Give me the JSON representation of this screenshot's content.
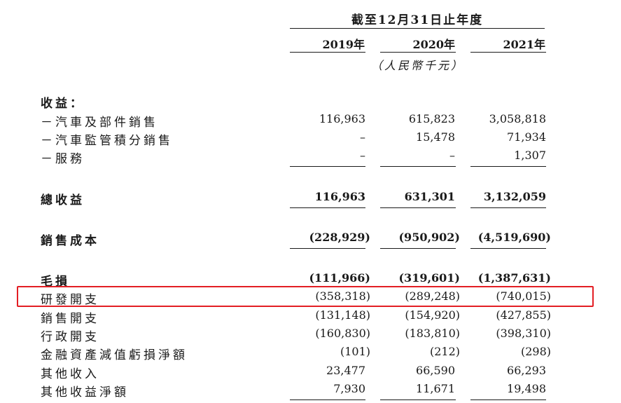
{
  "header": {
    "title": "截至12月31日止年度",
    "years": [
      "2019年",
      "2020年",
      "2021年"
    ],
    "unit": "（人民幣千元）"
  },
  "rows": {
    "revenue_heading": "收益：",
    "vehicle_sales": {
      "label": "－汽車及部件銷售",
      "values": [
        "116,963",
        "615,823",
        "3,058,818"
      ]
    },
    "credit_sales": {
      "label": "－汽車監管積分銷售",
      "values": [
        "–",
        "15,478",
        "71,934"
      ]
    },
    "services": {
      "label": "－服務",
      "values": [
        "–",
        "–",
        "1,307"
      ]
    },
    "total_revenue": {
      "label": "總收益",
      "values": [
        "116,963",
        "631,301",
        "3,132,059"
      ]
    },
    "cost_of_sales": {
      "label": "銷售成本",
      "values": [
        "(228,929)",
        "(950,902)",
        "(4,519,690)"
      ]
    },
    "gross_loss": {
      "label": "毛損",
      "values": [
        "(111,966)",
        "(319,601)",
        "(1,387,631)"
      ]
    },
    "rd_expenses": {
      "label": "研發開支",
      "values": [
        "(358,318)",
        "(289,248)",
        "(740,015)"
      ]
    },
    "selling_expenses": {
      "label": "銷售開支",
      "values": [
        "(131,148)",
        "(154,920)",
        "(427,855)"
      ]
    },
    "admin_expenses": {
      "label": "行政開支",
      "values": [
        "(160,830)",
        "(183,810)",
        "(398,310)"
      ]
    },
    "impairment_losses": {
      "label": "金融資產減值虧損淨額",
      "values": [
        "(101)",
        "(212)",
        "(298)"
      ]
    },
    "other_income": {
      "label": "其他收入",
      "values": [
        "23,477",
        "66,590",
        "66,293"
      ]
    },
    "other_gains": {
      "label": "其他收益淨額",
      "values": [
        "7,930",
        "11,671",
        "19,498"
      ]
    }
  },
  "colors": {
    "highlight_border": "#e31e24",
    "text": "#1a1a1a"
  }
}
